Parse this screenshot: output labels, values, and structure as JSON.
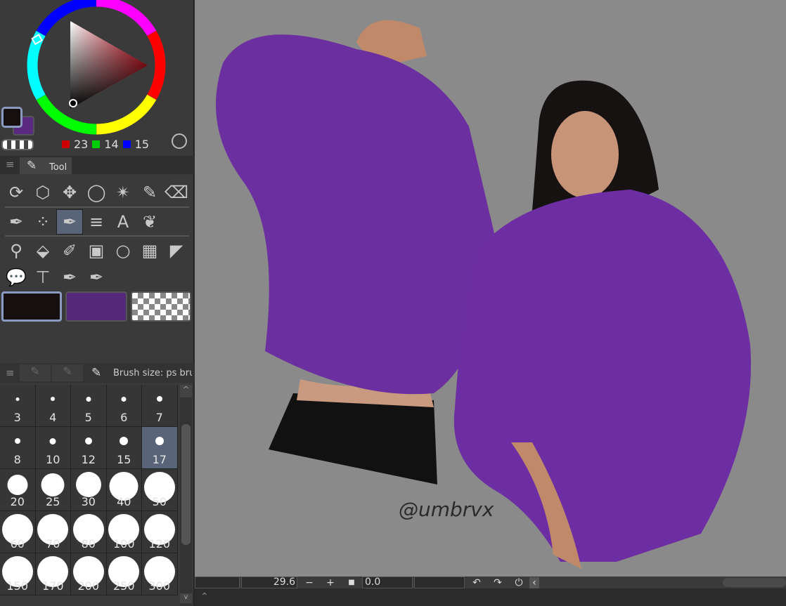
{
  "color": {
    "r": "23",
    "g": "14",
    "b": "15",
    "main_color": "#170e0f",
    "sub_color": "#5a2a80"
  },
  "tool_panel": {
    "tab_label": "Tool",
    "rows": [
      [
        "rotate-icon",
        "object-select-icon",
        "move-icon",
        "lasso-icon",
        "magic-wand-icon",
        "eyedropper-icon",
        "eraser-icon"
      ],
      [
        "pen-icon",
        "airbrush-icon",
        "pen-selected-icon",
        "lines-icon",
        "text-icon",
        "blend-icon"
      ],
      [
        "zoom-icon",
        "fill-icon",
        "marker-icon",
        "gradient-icon",
        "ellipse-icon",
        "frame-icon",
        "ruler-icon"
      ],
      [
        "balloon-icon",
        "correct-line-icon",
        "pen-alt-icon",
        "pen-alt2-icon"
      ]
    ],
    "glyphs": [
      [
        "⟳",
        "⬡",
        "✥",
        "◯",
        "✴",
        "✎",
        "⌫"
      ],
      [
        "✒",
        "⁘",
        "✒",
        "≡",
        "A",
        "❦"
      ],
      [
        "⚲",
        "⬙",
        "✐",
        "▣",
        "○",
        "▦",
        "◤"
      ],
      [
        "💬",
        "⊤",
        "✒",
        "✒"
      ]
    ]
  },
  "brush_size": {
    "title": "Brush size: ps bru",
    "sizes": [
      "3",
      "4",
      "5",
      "6",
      "7",
      "8",
      "10",
      "12",
      "15",
      "17",
      "20",
      "25",
      "30",
      "40",
      "50",
      "60",
      "70",
      "80",
      "100",
      "120",
      "150",
      "170",
      "200",
      "250",
      "300"
    ],
    "selected": "17"
  },
  "canvas": {
    "watermark": "@umbrvx"
  },
  "bottom_bar": {
    "zoom": "29.6",
    "minus": "−",
    "plus": "+",
    "angle": "0.0",
    "collapse": "‹",
    "expand": "⌃"
  }
}
